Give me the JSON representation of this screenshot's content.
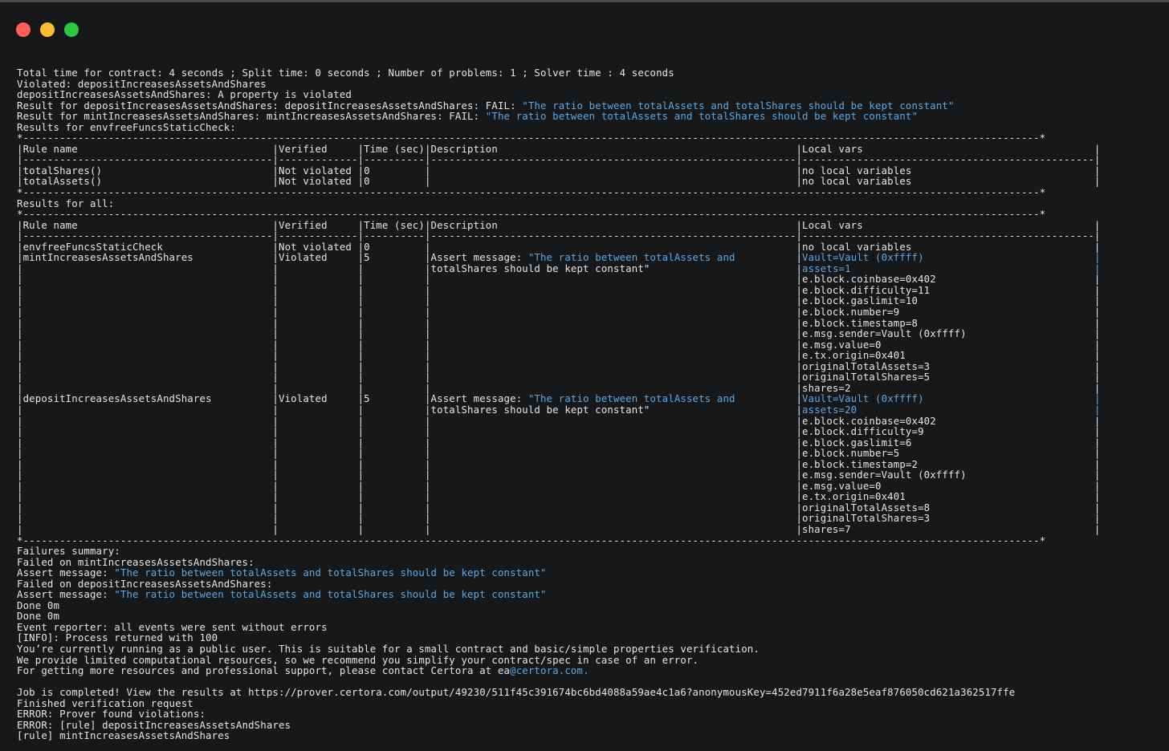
{
  "window": {
    "buttons": [
      "close",
      "minimize",
      "maximize"
    ],
    "colors": {
      "close": "#ff5f57",
      "minimize": "#febc2e",
      "maximize": "#28c840",
      "background": "#17181a",
      "text": "#e6e6e6",
      "highlight": "#5aa9e6"
    }
  },
  "terminal": {
    "lines": [
      [
        {
          "t": "Total time for contract: 4 seconds ; Split time: 0 seconds ; Number of problems: 1 ; Solver time : 4 seconds"
        }
      ],
      [
        {
          "t": "Violated: depositIncreasesAssetsAndShares"
        }
      ],
      [
        {
          "t": "depositIncreasesAssetsAndShares: A property is violated"
        }
      ],
      [
        {
          "t": "Result for depositIncreasesAssetsAndShares: depositIncreasesAssetsAndShares: FAIL: "
        },
        {
          "t": "\"The ratio between totalAssets and totalShares should be kept constant\"",
          "h": true
        }
      ],
      [
        {
          "t": "Result for mintIncreasesAssetsAndShares: mintIncreasesAssetsAndShares: FAIL: "
        },
        {
          "t": "\"The ratio between totalAssets and totalShares should be kept constant\"",
          "h": true
        }
      ],
      [
        {
          "t": "Results for envfreeFuncsStaticCheck:"
        }
      ],
      [
        {
          "t": "*-----------------------------------------------------------------------------------------------------------------------------------------------------------------------*"
        }
      ],
      [
        {
          "t": "|Rule name                                |Verified     |Time (sec)|Description                                                 |Local vars                                      |"
        }
      ],
      [
        {
          "t": "|-----------------------------------------|-------------|----------|------------------------------------------------------------|------------------------------------------------|"
        }
      ],
      [
        {
          "t": "|totalShares()                            |Not violated |0         |                                                            |no local variables                              |"
        }
      ],
      [
        {
          "t": "|totalAssets()                            |Not violated |0         |                                                            |no local variables                              |"
        }
      ],
      [
        {
          "t": "*-----------------------------------------------------------------------------------------------------------------------------------------------------------------------*"
        }
      ],
      [
        {
          "t": "Results for all:"
        }
      ],
      [
        {
          "t": "*-----------------------------------------------------------------------------------------------------------------------------------------------------------------------*"
        }
      ],
      [
        {
          "t": "|Rule name                                |Verified     |Time (sec)|Description                                                 |Local vars                                      |"
        }
      ],
      [
        {
          "t": "|-----------------------------------------|-------------|----------|------------------------------------------------------------|------------------------------------------------|"
        }
      ],
      [
        {
          "t": "|envfreeFuncsStaticCheck                  |Not violated |0         |                                                            |no local variables                              |"
        }
      ],
      [
        {
          "t": "|mintIncreasesAssetsAndShares             |Violated     |5         |Assert message: "
        },
        {
          "t": "\"The ratio between totalAssets and",
          "h": true
        },
        {
          "t": "          |"
        },
        {
          "t": "Vault=Vault (0xffff)                            |",
          "h": true
        }
      ],
      [
        {
          "t": "|                                         |             |          |totalShares should be kept constant\"                        |"
        },
        {
          "t": "assets=1                                        |",
          "h": true
        }
      ],
      [
        {
          "t": "|                                         |             |          |                                                            |e.block.coinbase=0x402                          |"
        }
      ],
      [
        {
          "t": "|                                         |             |          |                                                            |e.block.difficulty=11                           |"
        }
      ],
      [
        {
          "t": "|                                         |             |          |                                                            |e.block.gaslimit=10                             |"
        }
      ],
      [
        {
          "t": "|                                         |             |          |                                                            |e.block.number=9                                |"
        }
      ],
      [
        {
          "t": "|                                         |             |          |                                                            |e.block.timestamp=8                             |"
        }
      ],
      [
        {
          "t": "|                                         |             |          |                                                            |e.msg.sender=Vault (0xffff)                     |"
        }
      ],
      [
        {
          "t": "|                                         |             |          |                                                            |e.msg.value=0                                   |"
        }
      ],
      [
        {
          "t": "|                                         |             |          |                                                            |e.tx.origin=0x401                               |"
        }
      ],
      [
        {
          "t": "|                                         |             |          |                                                            |originalTotalAssets=3                           |"
        }
      ],
      [
        {
          "t": "|                                         |             |          |                                                            |originalTotalShares=5                           |"
        }
      ],
      [
        {
          "t": "|                                         |             |          |                                                            |shares=2                                        |"
        }
      ],
      [
        {
          "t": "|depositIncreasesAssetsAndShares          |Violated     |5         |Assert message: "
        },
        {
          "t": "\"The ratio between totalAssets and",
          "h": true
        },
        {
          "t": "          |"
        },
        {
          "t": "Vault=Vault (0xffff)                            |",
          "h": true
        }
      ],
      [
        {
          "t": "|                                         |             |          |totalShares should be kept constant\"                        |"
        },
        {
          "t": "assets=20                                       |",
          "h": true
        }
      ],
      [
        {
          "t": "|                                         |             |          |                                                            |e.block.coinbase=0x402                          |"
        }
      ],
      [
        {
          "t": "|                                         |             |          |                                                            |e.block.difficulty=9                            |"
        }
      ],
      [
        {
          "t": "|                                         |             |          |                                                            |e.block.gaslimit=6                              |"
        }
      ],
      [
        {
          "t": "|                                         |             |          |                                                            |e.block.number=5                                |"
        }
      ],
      [
        {
          "t": "|                                         |             |          |                                                            |e.block.timestamp=2                             |"
        }
      ],
      [
        {
          "t": "|                                         |             |          |                                                            |e.msg.sender=Vault (0xffff)                     |"
        }
      ],
      [
        {
          "t": "|                                         |             |          |                                                            |e.msg.value=0                                   |"
        }
      ],
      [
        {
          "t": "|                                         |             |          |                                                            |e.tx.origin=0x401                               |"
        }
      ],
      [
        {
          "t": "|                                         |             |          |                                                            |originalTotalAssets=8                           |"
        }
      ],
      [
        {
          "t": "|                                         |             |          |                                                            |originalTotalShares=3                           |"
        }
      ],
      [
        {
          "t": "|                                         |             |          |                                                            |shares=7                                        |"
        }
      ],
      [
        {
          "t": "*-----------------------------------------------------------------------------------------------------------------------------------------------------------------------*"
        }
      ],
      [
        {
          "t": "Failures summary:"
        }
      ],
      [
        {
          "t": "Failed on mintIncreasesAssetsAndShares:"
        }
      ],
      [
        {
          "t": "Assert message: "
        },
        {
          "t": "\"The ratio between totalAssets and totalShares should be kept constant\"",
          "h": true
        }
      ],
      [
        {
          "t": "Failed on depositIncreasesAssetsAndShares:"
        }
      ],
      [
        {
          "t": "Assert message: "
        },
        {
          "t": "\"The ratio between totalAssets and totalShares should be kept constant\"",
          "h": true
        }
      ],
      [
        {
          "t": "Done 0m"
        }
      ],
      [
        {
          "t": "Done 0m"
        }
      ],
      [
        {
          "t": "Event reporter: all events were sent without errors"
        }
      ],
      [
        {
          "t": "[INFO]: Process returned with 100"
        }
      ],
      [
        {
          "t": "You’re currently running as a public user. This is suitable for a small contract and basic/simple properties verification."
        }
      ],
      [
        {
          "t": "We provide limited computational resources, so we recommend you simplify your contract/spec in case of an error."
        }
      ],
      [
        {
          "t": "For getting more resources and professional support, please contact Certora at ea"
        },
        {
          "t": "@certora.com.",
          "h": true
        }
      ],
      [
        {
          "t": ""
        }
      ],
      [
        {
          "t": "Job is completed! View the results at https://prover.certora.com/output/49230/511f45c391674bc6bd4088a59ae4c1a6?anonymousKey=452ed7911f6a28e5eaf876050cd621a362517ffe"
        }
      ],
      [
        {
          "t": "Finished verification request"
        }
      ],
      [
        {
          "t": "ERROR: Prover found violations:"
        }
      ],
      [
        {
          "t": "ERROR: [rule] depositIncreasesAssetsAndShares"
        }
      ],
      [
        {
          "t": "[rule] mintIncreasesAssetsAndShares"
        }
      ]
    ]
  }
}
